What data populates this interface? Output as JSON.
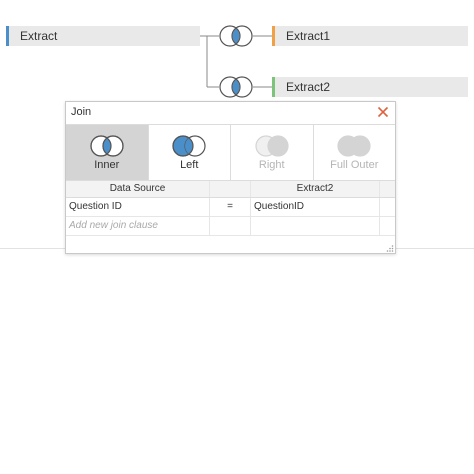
{
  "flow": {
    "left_table": "Extract",
    "right_tables": [
      "Extract1",
      "Extract2"
    ]
  },
  "join_dialog": {
    "title": "Join",
    "join_types": [
      {
        "label": "Inner",
        "state": "selected"
      },
      {
        "label": "Left",
        "state": "normal"
      },
      {
        "label": "Right",
        "state": "disabled"
      },
      {
        "label": "Full Outer",
        "state": "disabled"
      }
    ],
    "columns": {
      "left": "Data Source",
      "right": "Extract2"
    },
    "clauses": [
      {
        "left": "Question ID",
        "op": "=",
        "right": "QuestionID"
      }
    ],
    "add_clause_placeholder": "Add new join clause"
  },
  "colors": {
    "join_blue": "#4a8fc9",
    "extract_bar": "#4a8fc9",
    "extract1_bar": "#f0a045",
    "extract2_bar": "#7cc47c",
    "close_x": "#e0603c"
  }
}
